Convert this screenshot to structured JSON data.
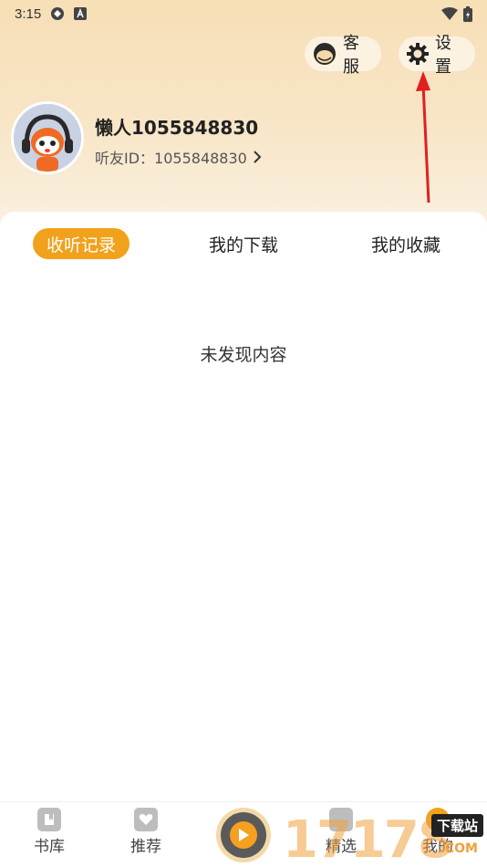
{
  "status_bar": {
    "time": "3:15"
  },
  "header": {
    "service_label": "客服",
    "settings_label": "设置"
  },
  "profile": {
    "username": "懒人1055848830",
    "id_label": "听友ID：1055848830"
  },
  "tabs": [
    {
      "label": "收听记录",
      "active": true
    },
    {
      "label": "我的下载",
      "active": false
    },
    {
      "label": "我的收藏",
      "active": false
    }
  ],
  "content": {
    "empty_message": "未发现内容"
  },
  "bottom_nav": {
    "items": [
      {
        "label": "书库",
        "icon": "book-icon"
      },
      {
        "label": "推荐",
        "icon": "heart-icon"
      },
      {
        "label": "精选",
        "icon": "star-icon"
      },
      {
        "label": "我的",
        "icon": "user-icon"
      }
    ]
  },
  "watermark": {
    "digits": "17178",
    "site": "下载站",
    "domain": ".COM"
  },
  "colors": {
    "accent": "#f2a11c",
    "header_top": "#f7dfb6",
    "annotation": "#e02020"
  }
}
